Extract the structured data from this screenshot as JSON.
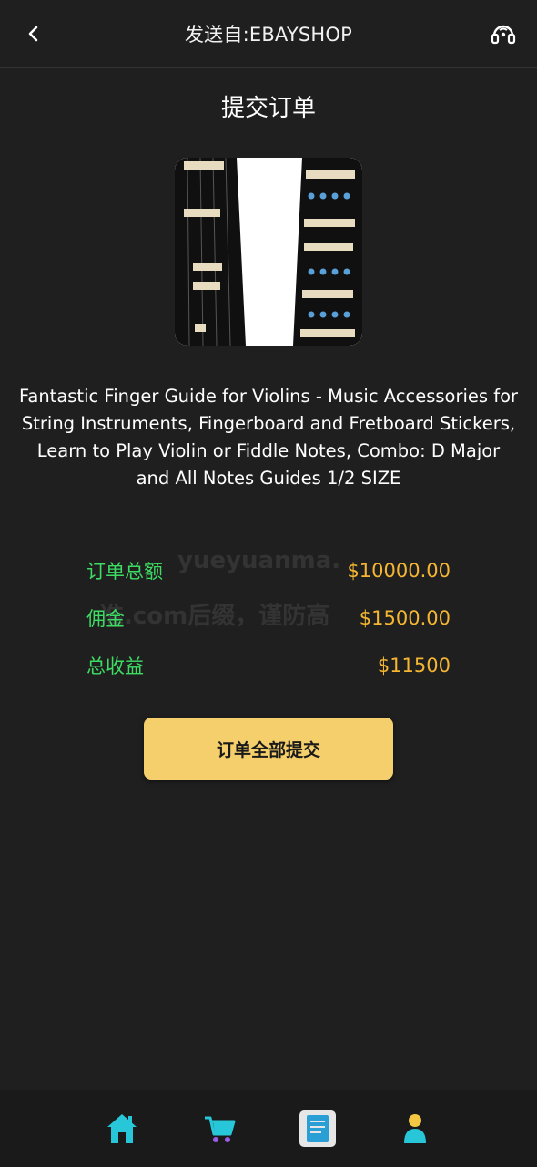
{
  "header": {
    "title": "发送自:EBAYSHOP",
    "back_icon": "chevron-left-icon",
    "support_icon": "headset-support-icon"
  },
  "page": {
    "heading": "提交订单"
  },
  "product": {
    "image_icon": "violin-finger-guide-image",
    "title": "Fantastic Finger Guide for Violins - Music Accessories for String Instruments, Fingerboard and Fretboard Stickers, Learn to Play Violin or Fiddle Notes, Combo: D Major and All Notes Guides 1/2 SIZE"
  },
  "summary": {
    "rows": [
      {
        "label": "订单总额",
        "value": "$10000.00"
      },
      {
        "label": "佣金",
        "value": "$1500.00"
      },
      {
        "label": "总收益",
        "value": "$11500"
      }
    ],
    "label_color": "#3ddc63",
    "value_color": "#f5b632"
  },
  "watermark": {
    "line1": "yueyuanma.",
    "line2": "准.com后缀，谨防高"
  },
  "actions": {
    "submit_label": "订单全部提交",
    "submit_color": "#f4cf6b"
  },
  "bottom_nav": {
    "items": [
      {
        "icon": "home-icon"
      },
      {
        "icon": "shopping-cart-icon"
      },
      {
        "icon": "order-list-icon"
      },
      {
        "icon": "user-profile-icon"
      }
    ]
  }
}
